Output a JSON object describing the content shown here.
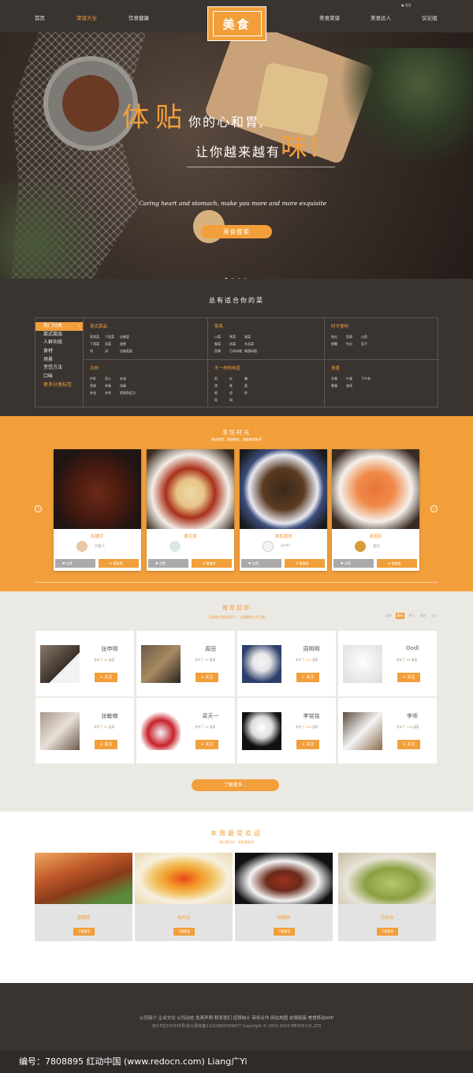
{
  "nav": {
    "left": [
      "首页",
      "菜谱大全",
      "饮食健康"
    ],
    "right": [
      "美食菜谱",
      "美食达人",
      "议论组"
    ],
    "logo": "美食",
    "login": "登录"
  },
  "hero": {
    "line1_big": "体贴",
    "line1_small": "你的心和胃,",
    "line2_small": "让你越来越有",
    "line2_big": "味!",
    "subtitle": "Caring heart and stomach, make you more and more exquisite",
    "button": "美食搜索"
  },
  "categories": {
    "title": "总有适合你的菜",
    "side": [
      "热门分类",
      "菜式菜品",
      "人群功效",
      "食材",
      "场景",
      "烹饪方法",
      "口味",
      "更多分类标签"
    ],
    "blocks": [
      {
        "head": "菜式菜品",
        "items": [
          "家常菜",
          "下饭菜",
          "自制菜",
          "下酒菜",
          "凉菜",
          "甜食",
          "烘",
          "汤",
          "自制菜面"
        ]
      },
      {
        "head": "菜系",
        "items": [
          "川菜",
          "粤菜",
          "湘菜",
          "鲁菜",
          "浙菜",
          "东北菜",
          "西餐",
          "日本料理",
          "韩国料理"
        ]
      },
      {
        "head": "时令食材",
        "items": [
          "南瓜",
          "西葫",
          "山药",
          "螃蟹",
          "冬瓜",
          "茄子"
        ]
      },
      {
        "head": "功效",
        "items": [
          "护肝",
          "养心",
          "补肾",
          "养胃",
          "补脑",
          "排毒",
          "补血",
          "补钙",
          "提高免疫力"
        ]
      },
      {
        "head": "不一样的味道",
        "items": [
          "煎",
          "炒",
          "腌",
          "烤",
          "煮",
          "蒸",
          "焖",
          "卤",
          "炸",
          "炝",
          "炖"
        ]
      },
      {
        "head": "场景",
        "items": [
          "早餐",
          "午餐",
          "下午茶",
          "晚餐",
          "夜宵"
        ]
      }
    ]
  },
  "featured": {
    "title": "烹饪时光",
    "subtitle": "精选推荐，精挑细选，健康美食推荐",
    "cards": [
      {
        "name": "焖猪手",
        "user": "刘美人",
        "like": "点赞",
        "view": "看美食"
      },
      {
        "name": "酱豆腐",
        "user": "",
        "like": "点赞",
        "view": "看美食"
      },
      {
        "name": "清蒸猪肉",
        "user": "yoshi",
        "like": "点赞",
        "view": "看美食"
      },
      {
        "name": "清蒸虾",
        "user": "爱吃",
        "like": "点赞",
        "view": "看美食"
      }
    ]
  },
  "chefs": {
    "title": "推荐厨师",
    "subtitle": "让健康饮食陪伴家人，让健康的生活习惯",
    "tabs": [
      "全部",
      "最新",
      "热门",
      "推荐",
      "达人"
    ],
    "list": [
      {
        "name": "张申明",
        "pre": "发布了",
        "count": "48",
        "post": "道菜"
      },
      {
        "name": "周田",
        "pre": "发布了",
        "count": "64",
        "post": "道菜"
      },
      {
        "name": "周明明",
        "pre": "发布了",
        "count": "102",
        "post": "道菜"
      },
      {
        "name": "Oodl",
        "pre": "发布了",
        "count": "66",
        "post": "道菜"
      },
      {
        "name": "张敏楠",
        "pre": "发布了",
        "count": "43",
        "post": "道菜"
      },
      {
        "name": "梁天一",
        "pre": "发布了",
        "count": "43",
        "post": "道菜"
      },
      {
        "name": "李铭铭",
        "pre": "发布了",
        "count": "100",
        "post": "道菜"
      },
      {
        "name": "李师",
        "pre": "发布了",
        "count": "138",
        "post": "道菜"
      }
    ],
    "follow": "+ 关注",
    "more": "了解更多..."
  },
  "popular": {
    "title": "本周最受欢迎",
    "subtitle": "园以食为天，食有营养初",
    "cards": [
      {
        "name": "卤猪蹄",
        "btn": "了解更多"
      },
      {
        "name": "炖木瓜",
        "btn": "了解更多"
      },
      {
        "name": "焖猪肉",
        "btn": "了解更多"
      },
      {
        "name": "凉瓜丝",
        "btn": "了解更多"
      }
    ]
  },
  "footer": {
    "links": "公司简介 企业文化 公司动态 免责声明 联系我们 招贤纳士 商务合作 网站地图 友情链接 美食移动APP",
    "copyright": "京ICP证150335号/京公网安备11010802009977 Copyright © 2003-2016 MEISHI.CO.,LTD"
  },
  "watermark": "编号：7808895    红动中国 (www.redocn.com)    Liang广Yi",
  "colors": {
    "accent": "#f29f3b",
    "dark": "#3a3431",
    "light": "#ebe9e4"
  }
}
